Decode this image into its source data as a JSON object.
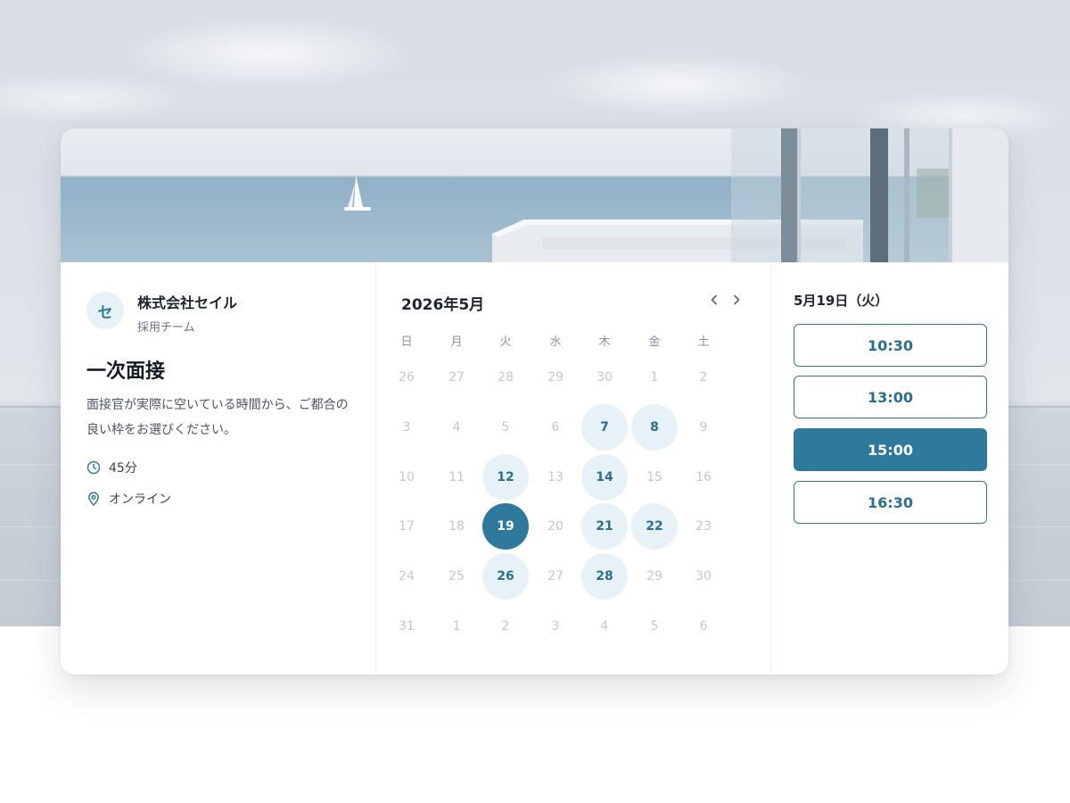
{
  "organizer": {
    "avatar_initial": "セ",
    "name": "株式会社セイル",
    "team": "採用チーム"
  },
  "event": {
    "title": "一次面接",
    "description": "面接官が実際に空いている時間から、ご都合の良い枠をお選びください。",
    "duration": "45分",
    "location": "オンライン"
  },
  "calendar": {
    "month_label": "2026年5月",
    "weekdays": [
      "日",
      "月",
      "火",
      "水",
      "木",
      "金",
      "土"
    ],
    "weeks": [
      [
        {
          "d": "26",
          "s": "out"
        },
        {
          "d": "27",
          "s": "out"
        },
        {
          "d": "28",
          "s": "out"
        },
        {
          "d": "29",
          "s": "out"
        },
        {
          "d": "30",
          "s": "out"
        },
        {
          "d": "1",
          "s": "off"
        },
        {
          "d": "2",
          "s": "off"
        }
      ],
      [
        {
          "d": "3",
          "s": "off"
        },
        {
          "d": "4",
          "s": "off"
        },
        {
          "d": "5",
          "s": "off"
        },
        {
          "d": "6",
          "s": "off"
        },
        {
          "d": "7",
          "s": "avail"
        },
        {
          "d": "8",
          "s": "avail"
        },
        {
          "d": "9",
          "s": "off"
        }
      ],
      [
        {
          "d": "10",
          "s": "off"
        },
        {
          "d": "11",
          "s": "off"
        },
        {
          "d": "12",
          "s": "avail"
        },
        {
          "d": "13",
          "s": "off"
        },
        {
          "d": "14",
          "s": "avail"
        },
        {
          "d": "15",
          "s": "off"
        },
        {
          "d": "16",
          "s": "off"
        }
      ],
      [
        {
          "d": "17",
          "s": "off"
        },
        {
          "d": "18",
          "s": "off"
        },
        {
          "d": "19",
          "s": "selected"
        },
        {
          "d": "20",
          "s": "off"
        },
        {
          "d": "21",
          "s": "avail"
        },
        {
          "d": "22",
          "s": "avail"
        },
        {
          "d": "23",
          "s": "off"
        }
      ],
      [
        {
          "d": "24",
          "s": "off"
        },
        {
          "d": "25",
          "s": "off"
        },
        {
          "d": "26",
          "s": "avail"
        },
        {
          "d": "27",
          "s": "off"
        },
        {
          "d": "28",
          "s": "avail"
        },
        {
          "d": "29",
          "s": "off"
        },
        {
          "d": "30",
          "s": "off"
        }
      ],
      [
        {
          "d": "31",
          "s": "off"
        },
        {
          "d": "1",
          "s": "out"
        },
        {
          "d": "2",
          "s": "out"
        },
        {
          "d": "3",
          "s": "out"
        },
        {
          "d": "4",
          "s": "out"
        },
        {
          "d": "5",
          "s": "out"
        },
        {
          "d": "6",
          "s": "out"
        }
      ]
    ]
  },
  "time_slots": {
    "date_heading": "5月19日（火）",
    "slots": [
      {
        "time": "10:30",
        "selected": false
      },
      {
        "time": "13:00",
        "selected": false
      },
      {
        "time": "15:00",
        "selected": true
      },
      {
        "time": "16:30",
        "selected": false
      }
    ]
  },
  "colors": {
    "accent": "#2f7a9c",
    "available_bg": "#e6f2f8",
    "text_dark": "#1c2530"
  },
  "icons": {
    "duration": "clock-icon",
    "location": "map-pin-icon",
    "prev": "chevron-left-icon",
    "next": "chevron-right-icon"
  }
}
